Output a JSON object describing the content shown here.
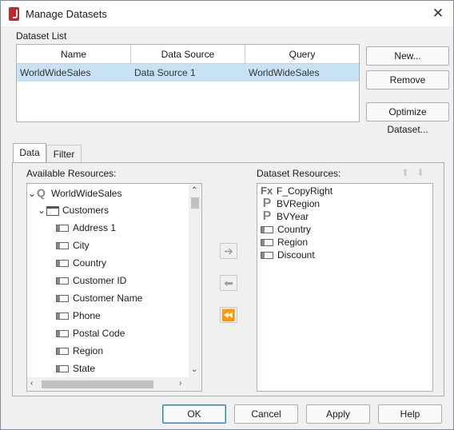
{
  "window": {
    "title": "Manage Datasets"
  },
  "dataset_list": {
    "label": "Dataset List",
    "columns": [
      "Name",
      "Data Source",
      "Query"
    ],
    "rows": [
      {
        "name": "WorldWideSales",
        "data_source": "Data Source 1",
        "query": "WorldWideSales",
        "selected": true
      }
    ]
  },
  "side_buttons": {
    "new": "New...",
    "remove": "Remove",
    "optimize": "Optimize Dataset..."
  },
  "tabs": {
    "data": "Data",
    "filter": "Filter",
    "active": "Data"
  },
  "available": {
    "label": "Available Resources:",
    "root": "WorldWideSales",
    "table": "Customers",
    "fields": [
      "Address 1",
      "City",
      "Country",
      "Customer ID",
      "Customer Name",
      "Phone",
      "Postal Code",
      "Region",
      "State"
    ]
  },
  "dataset_resources": {
    "label": "Dataset Resources:",
    "items": [
      {
        "icon": "formula-icon",
        "label": "F_CopyRight"
      },
      {
        "icon": "parameter-icon",
        "label": "BVRegion"
      },
      {
        "icon": "parameter-icon",
        "label": "BVYear"
      },
      {
        "icon": "field-icon",
        "label": "Country"
      },
      {
        "icon": "field-icon",
        "label": "Region"
      },
      {
        "icon": "field-icon",
        "label": "Discount"
      }
    ]
  },
  "footer": {
    "ok": "OK",
    "cancel": "Cancel",
    "apply": "Apply",
    "help": "Help"
  }
}
